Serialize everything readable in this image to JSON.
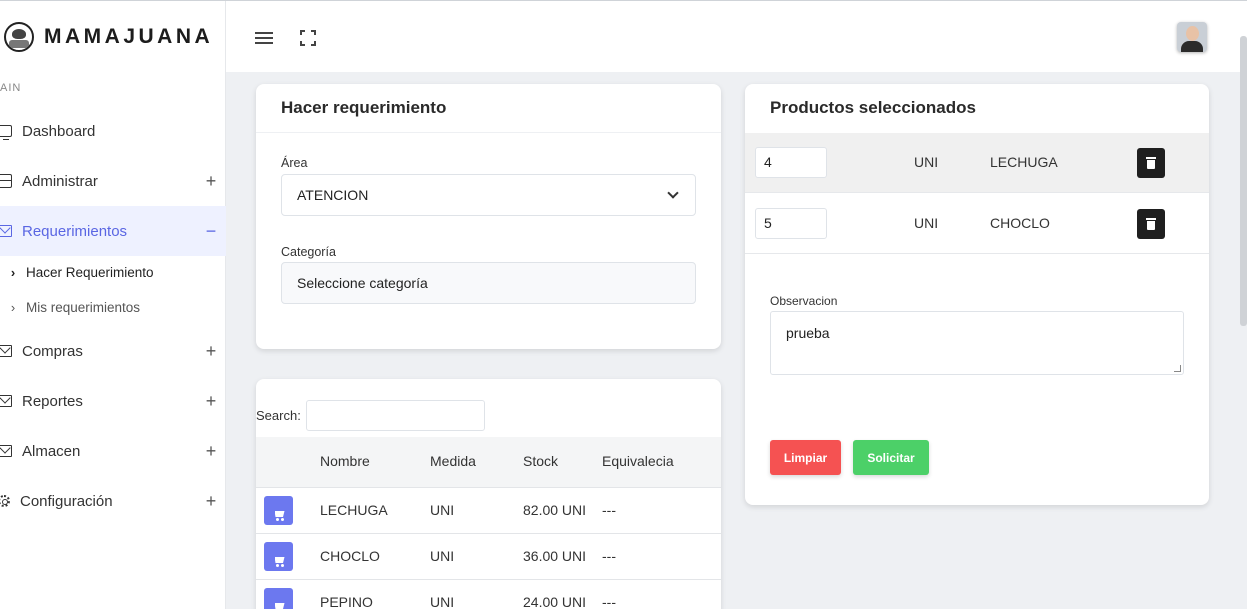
{
  "brand": {
    "name": "MAMAJUANA"
  },
  "sidebar": {
    "section": "AIN",
    "items": [
      {
        "label": "Dashboard",
        "icon": "monitor-icon",
        "toggle": ""
      },
      {
        "label": "Administrar",
        "icon": "server-icon",
        "toggle": "+"
      },
      {
        "label": "Requerimientos",
        "icon": "mail-icon",
        "toggle": "−"
      },
      {
        "label": "Compras",
        "icon": "mail-icon",
        "toggle": "+"
      },
      {
        "label": "Reportes",
        "icon": "mail-icon",
        "toggle": "+"
      },
      {
        "label": "Almacen",
        "icon": "mail-icon",
        "toggle": "+"
      },
      {
        "label": "Configuración",
        "icon": "gear-icon",
        "toggle": "+"
      }
    ],
    "subitems": [
      {
        "label": "Hacer Requerimiento",
        "chev": "›"
      },
      {
        "label": "Mis requerimientos",
        "chev": "›"
      }
    ]
  },
  "request_card": {
    "title": "Hacer requerimiento",
    "area_label": "Área",
    "area_value": "ATENCION",
    "category_label": "Categoría",
    "category_placeholder": "Seleccione categoría"
  },
  "products_table": {
    "search_label": "Search:",
    "headers": [
      "Nombre",
      "Medida",
      "Stock",
      "Equivalecia"
    ],
    "rows": [
      {
        "name": "LECHUGA",
        "unit": "UNI",
        "stock": "82.00 UNI",
        "equiv": "---"
      },
      {
        "name": "CHOCLO",
        "unit": "UNI",
        "stock": "36.00 UNI",
        "equiv": "---"
      },
      {
        "name": "PEPINO",
        "unit": "UNI",
        "stock": "24.00 UNI",
        "equiv": "---"
      }
    ]
  },
  "selected_card": {
    "title": "Productos seleccionados",
    "items": [
      {
        "qty": "4",
        "unit": "UNI",
        "name": "LECHUGA"
      },
      {
        "qty": "5",
        "unit": "UNI",
        "name": "CHOCLO"
      }
    ],
    "observation_label": "Observacion",
    "observation_value": "prueba",
    "clear_label": "Limpiar",
    "submit_label": "Solicitar"
  },
  "colors": {
    "accent": "#5a66e3",
    "cart_button": "#6c78ef",
    "danger": "#f55252",
    "success": "#4cd068",
    "dark": "#1f1f1f"
  }
}
